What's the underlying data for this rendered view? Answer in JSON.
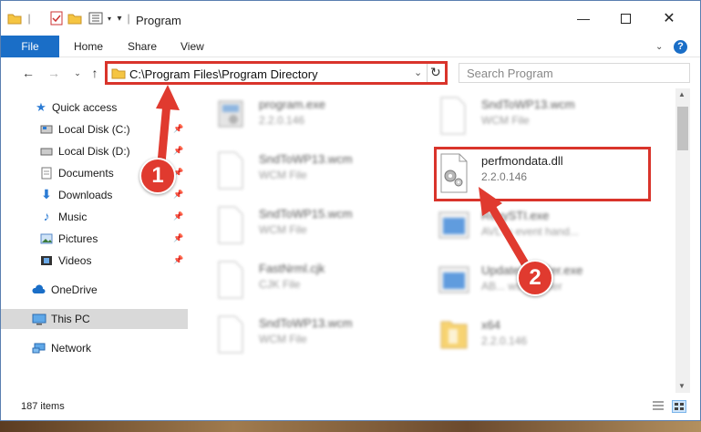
{
  "window": {
    "title": "Program"
  },
  "ribbon": {
    "tabs": [
      "File",
      "Home",
      "Share",
      "View"
    ]
  },
  "nav": {
    "address": "C:\\Program Files\\Program Directory",
    "search_placeholder": "Search Program"
  },
  "sidebar": {
    "items": [
      {
        "label": "Quick access"
      },
      {
        "label": "Local Disk (C:)"
      },
      {
        "label": "Local Disk (D:)"
      },
      {
        "label": "Documents"
      },
      {
        "label": "Downloads"
      },
      {
        "label": "Music"
      },
      {
        "label": "Pictures"
      },
      {
        "label": "Videos"
      },
      {
        "label": "OneDrive"
      },
      {
        "label": "This PC"
      },
      {
        "label": "Network"
      }
    ]
  },
  "files": [
    {
      "name": "program.exe",
      "meta": "2.2.0.146"
    },
    {
      "name": "SndToWP13.wcm",
      "meta": "WCM File"
    },
    {
      "name": "SndToWP13.wcm",
      "meta": "WCM File"
    },
    {
      "name": "perfmondata.dll",
      "meta": "2.2.0.146"
    },
    {
      "name": "SndToWP15.wcm",
      "meta": "WCM File"
    },
    {
      "name": "ReyySTI.exe",
      "meta": "AVL in event hand..."
    },
    {
      "name": "FastNrml.cjk",
      "meta": "CJK File"
    },
    {
      "name": "UpdateInstaller.exe",
      "meta": "AB... ws installer"
    },
    {
      "name": "SndToWP13.wcm",
      "meta": "WCM File"
    },
    {
      "name": "x64",
      "meta": "2.2.0.146"
    }
  ],
  "status": {
    "items": "187 items"
  },
  "annotations": {
    "step1": "1",
    "step2": "2"
  },
  "colors": {
    "accent": "#1a6ec7",
    "highlight": "#d9342b"
  }
}
